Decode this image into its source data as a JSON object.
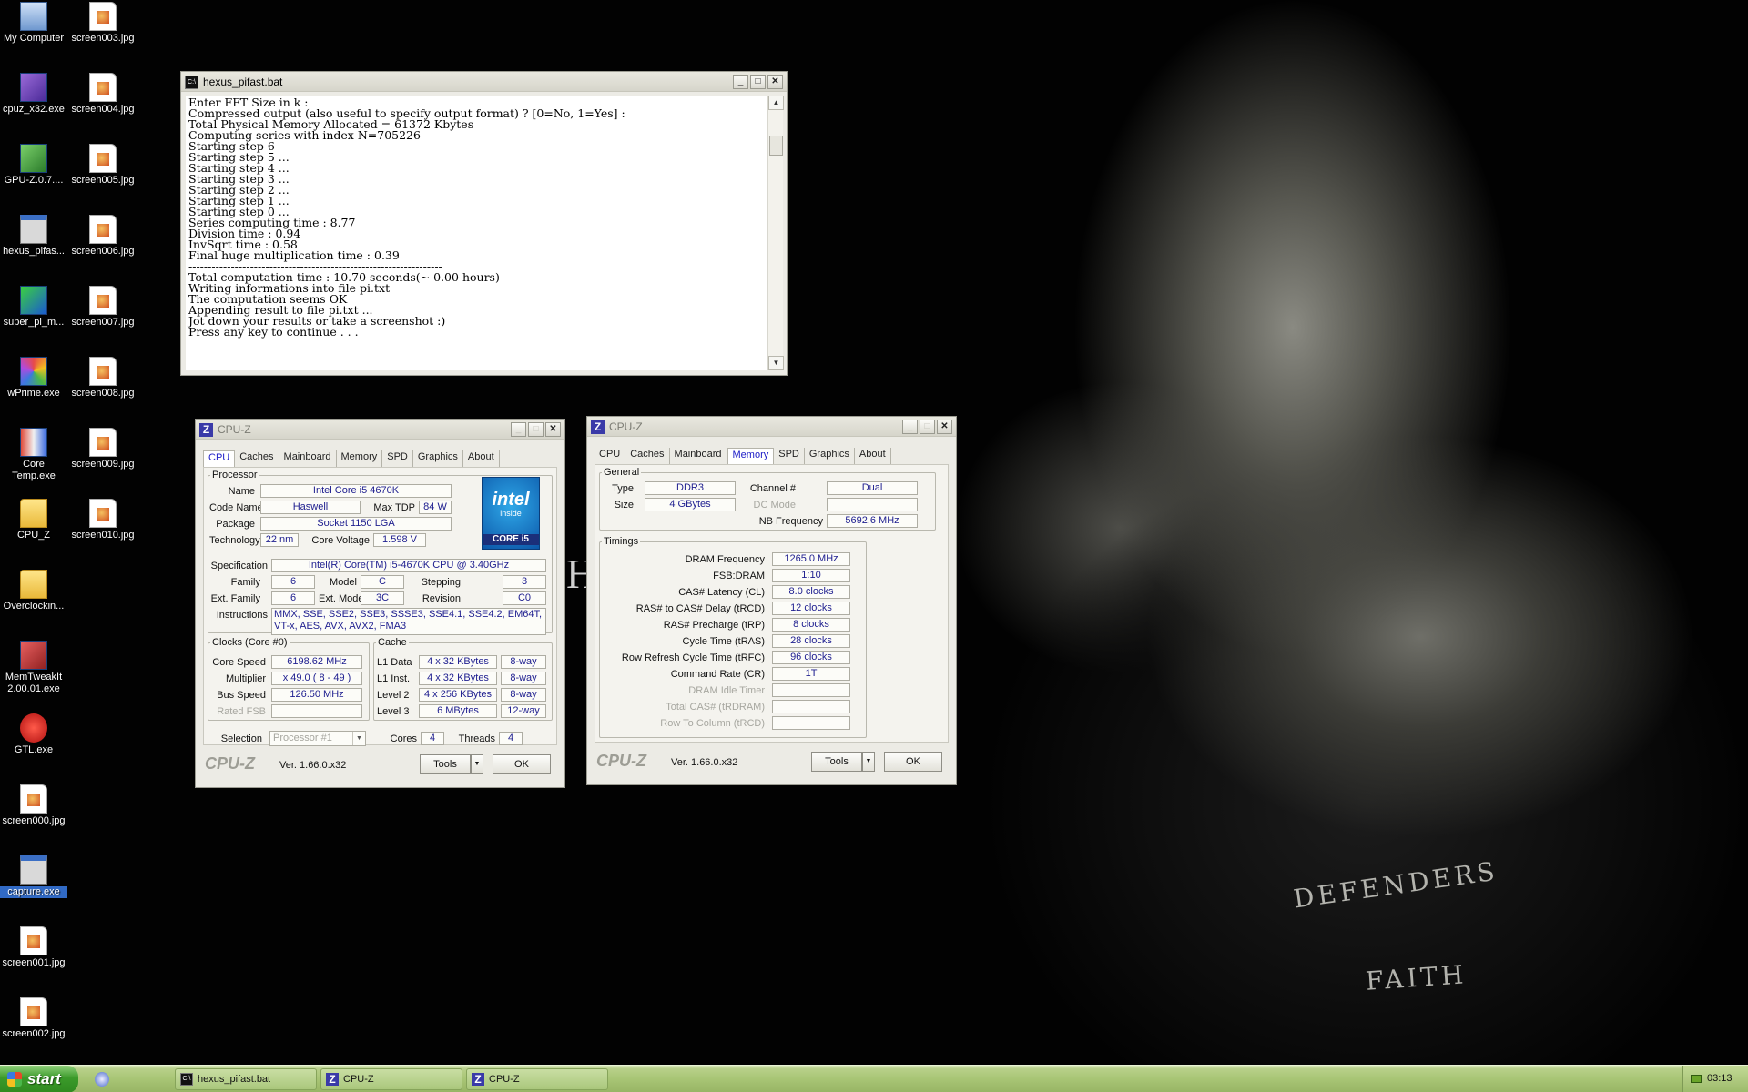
{
  "desktop": {
    "icons": [
      {
        "label": "My Computer",
        "icon": "my-computer-icon"
      },
      {
        "label": "screen003.jpg",
        "icon": "jpg-file-icon"
      },
      {
        "label": "cpuz_x32.exe",
        "icon": "cpuz-icon"
      },
      {
        "label": "screen004.jpg",
        "icon": "jpg-file-icon"
      },
      {
        "label": "GPU-Z.0.7....",
        "icon": "gpu-z-icon"
      },
      {
        "label": "screen005.jpg",
        "icon": "jpg-file-icon"
      },
      {
        "label": "hexus_pifas...",
        "icon": "hexus-pifast-icon"
      },
      {
        "label": "screen006.jpg",
        "icon": "jpg-file-icon"
      },
      {
        "label": "super_pi_m...",
        "icon": "super-pi-icon"
      },
      {
        "label": "screen007.jpg",
        "icon": "jpg-file-icon"
      },
      {
        "label": "wPrime.exe",
        "icon": "wprime-icon"
      },
      {
        "label": "screen008.jpg",
        "icon": "jpg-file-icon"
      },
      {
        "label": "Core Temp.exe",
        "icon": "core-temp-icon"
      },
      {
        "label": "screen009.jpg",
        "icon": "jpg-file-icon"
      },
      {
        "label": "CPU_Z",
        "icon": "folder-icon"
      },
      {
        "label": "screen010.jpg",
        "icon": "jpg-file-icon"
      },
      {
        "label": "Overclockin...",
        "icon": "folder-icon"
      },
      {
        "label": "MemTweakIt 2.00.01.exe",
        "icon": "memtweakit-icon"
      },
      {
        "label": "GTL.exe",
        "icon": "gtl-icon"
      },
      {
        "label": "screen000.jpg",
        "icon": "jpg-file-icon"
      },
      {
        "label": "capture.exe",
        "icon": "capture-icon"
      },
      {
        "label": "screen001.jpg",
        "icon": "jpg-file-icon"
      },
      {
        "label": "screen002.jpg",
        "icon": "jpg-file-icon"
      }
    ],
    "wallpaper_text": {
      "line1": "DEFENDERS",
      "line2": "FAITH",
      "ghost": "H"
    }
  },
  "console": {
    "title": "hexus_pifast.bat",
    "lines": [
      "Enter FFT Size in k :",
      "Compressed output (also useful to specify output format) ? [0=No, 1=Yes] :",
      "Total Physical Memory Allocated = 61372 Kbytes",
      "Computing series with index N=705226",
      "Starting step 6",
      "Starting step 5 ...",
      "Starting step 4 ...",
      "Starting step 3 ...",
      "Starting step 2 ...",
      "Starting step 1 ...",
      "Starting step 0 ...",
      "Series computing time : 8.77",
      "Division time : 0.94",
      "InvSqrt time : 0.58",
      "Final huge multiplication time : 0.39",
      "------------------------------------------------------------------",
      "Total computation time : 10.70 seconds(~ 0.00 hours)",
      "Writing informations into file pi.txt",
      "",
      "The computation seems OK",
      "Appending result to file pi.txt ...",
      "",
      "Jot down your results or take a screenshot :)",
      "Press any key to continue . . ."
    ]
  },
  "cpuz_cpu": {
    "title": "CPU-Z",
    "tabs": [
      "CPU",
      "Caches",
      "Mainboard",
      "Memory",
      "SPD",
      "Graphics",
      "About"
    ],
    "active_tab": "CPU",
    "processor": {
      "legend": "Processor",
      "name_label": "Name",
      "name": "Intel Core i5 4670K",
      "codename_label": "Code Name",
      "codename": "Haswell",
      "maxtdp_label": "Max TDP",
      "maxtdp": "84 W",
      "package_label": "Package",
      "package": "Socket 1150 LGA",
      "technology_label": "Technology",
      "technology": "22 nm",
      "corevoltage_label": "Core Voltage",
      "corevoltage": "1.598 V",
      "specification_label": "Specification",
      "specification": "Intel(R) Core(TM) i5-4670K CPU @ 3.40GHz",
      "family_label": "Family",
      "family": "6",
      "model_label": "Model",
      "model": "C",
      "stepping_label": "Stepping",
      "stepping": "3",
      "extfamily_label": "Ext. Family",
      "extfamily": "6",
      "extmodel_label": "Ext. Model",
      "extmodel": "3C",
      "revision_label": "Revision",
      "revision": "C0",
      "instructions_label": "Instructions",
      "instructions": "MMX, SSE, SSE2, SSE3, SSSE3, SSE4.1, SSE4.2, EM64T, VT-x, AES, AVX, AVX2, FMA3",
      "logo": {
        "line1": "intel",
        "line2": "inside",
        "line3": "CORE i5"
      }
    },
    "clocks": {
      "legend": "Clocks (Core #0)",
      "corespeed_label": "Core Speed",
      "corespeed": "6198.62 MHz",
      "multiplier_label": "Multiplier",
      "multiplier": "x 49.0 ( 8 - 49 )",
      "busspeed_label": "Bus Speed",
      "busspeed": "126.50 MHz",
      "ratedfsb_label": "Rated FSB",
      "ratedfsb": ""
    },
    "cache": {
      "legend": "Cache",
      "l1d_label": "L1 Data",
      "l1d": "4 x 32 KBytes",
      "l1d_way": "8-way",
      "l1i_label": "L1 Inst.",
      "l1i": "4 x 32 KBytes",
      "l1i_way": "8-way",
      "l2_label": "Level 2",
      "l2": "4 x 256 KBytes",
      "l2_way": "8-way",
      "l3_label": "Level 3",
      "l3": "6 MBytes",
      "l3_way": "12-way"
    },
    "selection_label": "Selection",
    "selection": "Processor #1",
    "cores_label": "Cores",
    "cores": "4",
    "threads_label": "Threads",
    "threads": "4",
    "footer": {
      "brand": "CPU-Z",
      "version": "Ver. 1.66.0.x32",
      "tools": "Tools",
      "ok": "OK"
    }
  },
  "cpuz_mem": {
    "title": "CPU-Z",
    "tabs": [
      "CPU",
      "Caches",
      "Mainboard",
      "Memory",
      "SPD",
      "Graphics",
      "About"
    ],
    "active_tab": "Memory",
    "general": {
      "legend": "General",
      "type_label": "Type",
      "type": "DDR3",
      "size_label": "Size",
      "size": "4 GBytes",
      "channel_label": "Channel #",
      "channel": "Dual",
      "dcmode_label": "DC Mode",
      "dcmode": "",
      "nbfreq_label": "NB Frequency",
      "nbfreq": "5692.6 MHz"
    },
    "timings": {
      "legend": "Timings",
      "rows": [
        {
          "label": "DRAM Frequency",
          "value": "1265.0 MHz",
          "dim": false
        },
        {
          "label": "FSB:DRAM",
          "value": "1:10",
          "dim": false
        },
        {
          "label": "CAS# Latency (CL)",
          "value": "8.0 clocks",
          "dim": false
        },
        {
          "label": "RAS# to CAS# Delay (tRCD)",
          "value": "12 clocks",
          "dim": false
        },
        {
          "label": "RAS# Precharge (tRP)",
          "value": "8 clocks",
          "dim": false
        },
        {
          "label": "Cycle Time (tRAS)",
          "value": "28 clocks",
          "dim": false
        },
        {
          "label": "Row Refresh Cycle Time (tRFC)",
          "value": "96 clocks",
          "dim": false
        },
        {
          "label": "Command Rate (CR)",
          "value": "1T",
          "dim": false
        },
        {
          "label": "DRAM Idle Timer",
          "value": "",
          "dim": true
        },
        {
          "label": "Total CAS# (tRDRAM)",
          "value": "",
          "dim": true
        },
        {
          "label": "Row To Column (tRCD)",
          "value": "",
          "dim": true
        }
      ]
    },
    "footer": {
      "brand": "CPU-Z",
      "version": "Ver. 1.66.0.x32",
      "tools": "Tools",
      "ok": "OK"
    }
  },
  "taskbar": {
    "start_label": "start",
    "tasks": [
      "hexus_pifast.bat",
      "CPU-Z",
      "CPU-Z"
    ],
    "clock": "03:13"
  }
}
